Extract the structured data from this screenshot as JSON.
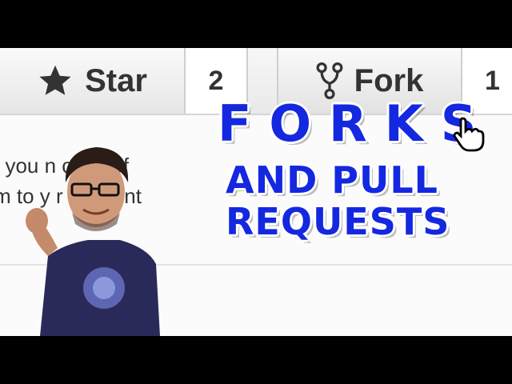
{
  "toolbar": {
    "star_label": "Star",
    "star_count": "2",
    "fork_label": "Fork",
    "fork_count": "1"
  },
  "description": {
    "line1": "t you     n copy of",
    "line2": "m to y    r account"
  },
  "overlay": {
    "title1": "FORKS",
    "title2": "AND PULL",
    "title3": "REQUESTS"
  },
  "icons": [
    "star-icon",
    "fork-icon",
    "hand-cursor-icon"
  ],
  "colors": {
    "title_blue": "#1428e0",
    "shirt": "#2a2a5a"
  }
}
